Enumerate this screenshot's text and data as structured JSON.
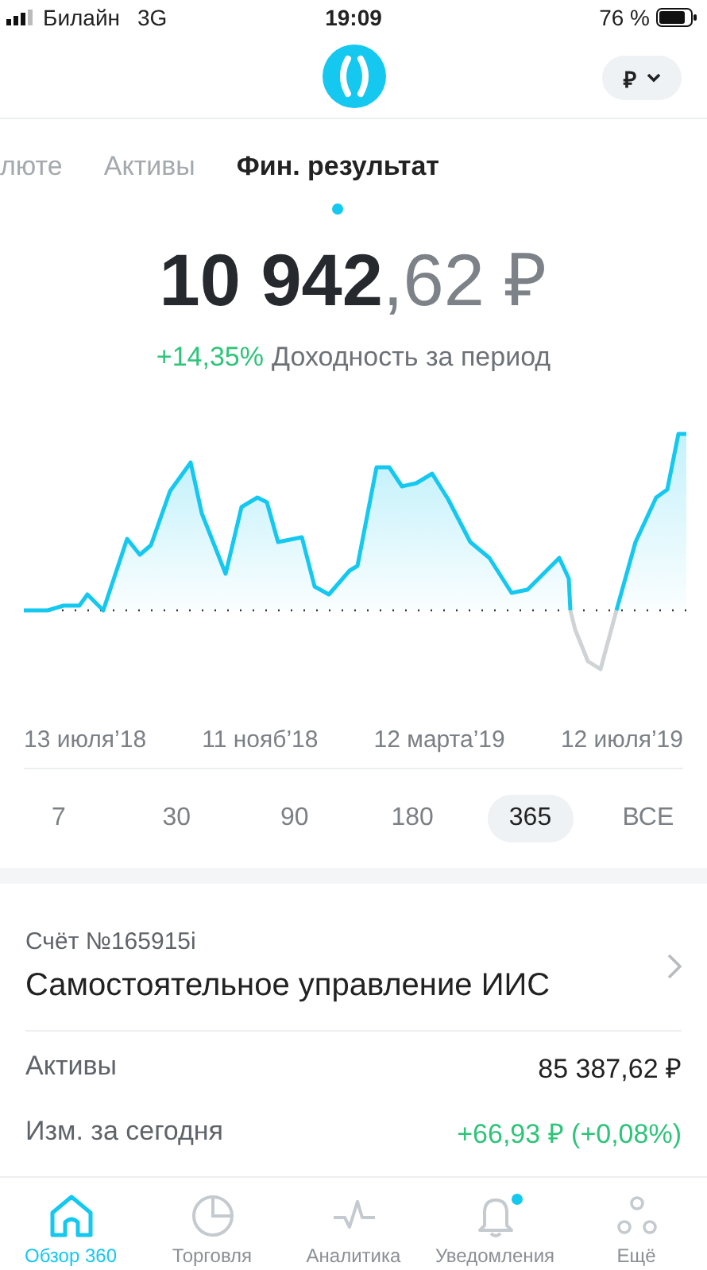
{
  "status_bar": {
    "carrier": "Билайн",
    "network": "3G",
    "time": "19:09",
    "battery": "76 %"
  },
  "header": {
    "currency": "₽"
  },
  "tabs": [
    {
      "label": "люте",
      "selected": false
    },
    {
      "label": "Активы",
      "selected": false
    },
    {
      "label": "Фин. результат",
      "selected": true
    }
  ],
  "summary": {
    "amount_whole": "10 942",
    "amount_fraction": ",62 ₽",
    "change": "+14,35%",
    "change_label": "Доходность за период"
  },
  "chart": {
    "x_labels": [
      "13 июля’18",
      "11 нояб’18",
      "12 марта’19",
      "12 июля’19"
    ]
  },
  "periods": [
    {
      "label": "7",
      "selected": false
    },
    {
      "label": "30",
      "selected": false
    },
    {
      "label": "90",
      "selected": false
    },
    {
      "label": "180",
      "selected": false
    },
    {
      "label": "365",
      "selected": true
    },
    {
      "label": "ВСЕ",
      "selected": false
    }
  ],
  "account": {
    "number": "Счёт №165915i",
    "title": "Самостоятельное управление ИИС",
    "rows": [
      {
        "label": "Активы",
        "value": "85 387,62 ₽",
        "positive": false
      },
      {
        "label": "Изм. за сегодня",
        "value": "+66,93 ₽ (+0,08%)",
        "positive": true
      }
    ]
  },
  "nav": [
    {
      "label": "Обзор 360",
      "kind": "home",
      "selected": true,
      "badge": false
    },
    {
      "label": "Торговля",
      "kind": "pie",
      "selected": false,
      "badge": false
    },
    {
      "label": "Аналитика",
      "kind": "pulse",
      "selected": false,
      "badge": false
    },
    {
      "label": "Уведомления",
      "kind": "bell",
      "selected": false,
      "badge": true
    },
    {
      "label": "Ещё",
      "kind": "more",
      "selected": false,
      "badge": false
    }
  ]
}
